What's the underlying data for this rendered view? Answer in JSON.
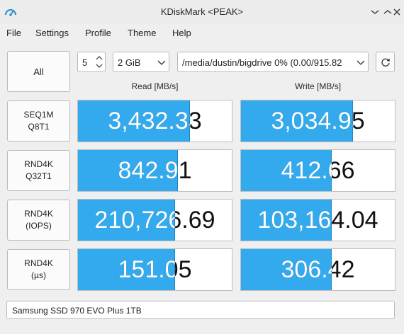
{
  "window": {
    "title": "KDiskMark <PEAK>",
    "controls": [
      "⌄",
      "⌃",
      "✕"
    ]
  },
  "menu": [
    "File",
    "Settings",
    "Profile",
    "Theme",
    "Help"
  ],
  "controls": {
    "all_label": "All",
    "loops": "5",
    "size": "2 GiB",
    "target": "/media/dustin/bigdrive 0% (0.00/915.82"
  },
  "columns": {
    "read": "Read [MB/s]",
    "write": "Write [MB/s]"
  },
  "rows": [
    {
      "line1": "SEQ1M",
      "line2": "Q8T1",
      "read": "3,432.33",
      "read_fill": 0.73,
      "write": "3,034.95",
      "write_fill": 0.73
    },
    {
      "line1": "RND4K",
      "line2": "Q32T1",
      "read": "842.91",
      "read_fill": 0.65,
      "write": "412.66",
      "write_fill": 0.59
    },
    {
      "line1": "RND4K",
      "line2": "(IOPS)",
      "read": "210,726.69",
      "read_fill": 0.63,
      "write": "103,164.04",
      "write_fill": 0.59
    },
    {
      "line1": "RND4K",
      "line2": "(µs)",
      "read": "151.05",
      "read_fill": 0.63,
      "write": "306.42",
      "write_fill": 0.59
    }
  ],
  "drive": "Samsung SSD 970 EVO Plus 1TB",
  "colors": {
    "bar": "#33aaee",
    "bar_edge": "#1f86c4",
    "window_bg": "#efefef"
  },
  "icons": [
    "app-icon",
    "spinner-arrows-icon",
    "chevron-down-icon",
    "refresh-icon"
  ]
}
